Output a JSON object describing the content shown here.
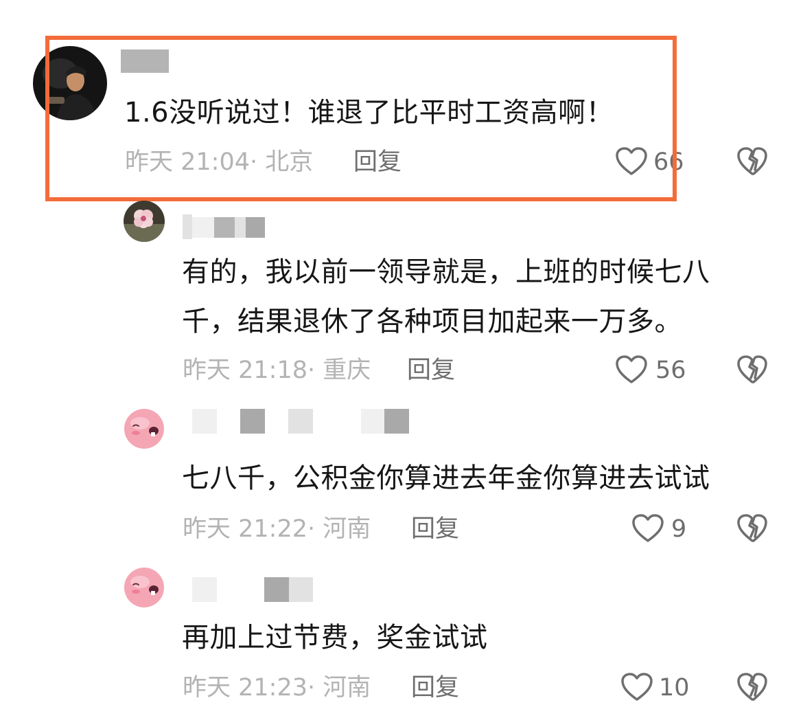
{
  "comments": [
    {
      "text_lines": [
        "1.6没听说过！谁退了比平时工资高啊！"
      ],
      "time": "昨天 21:04",
      "location": "· 北京",
      "reply_label": "回复",
      "likes": "66",
      "highlighted": true
    },
    {
      "text_lines": [
        "有的，我以前一领导就是，上班的时候七八",
        "千，结果退休了各种项目加起来一万多。"
      ],
      "time": "昨天 21:18",
      "location": "· 重庆",
      "reply_label": "回复",
      "likes": "56"
    },
    {
      "text_lines": [
        "七八千，公积金你算进去年金你算进去试试"
      ],
      "time": "昨天 21:22",
      "location": "· 河南",
      "reply_label": "回复",
      "likes": "9"
    },
    {
      "text_lines": [
        "再加上过节费，奖金试试"
      ],
      "time": "昨天 21:23",
      "location": "· 河南",
      "reply_label": "回复",
      "likes": "10"
    }
  ],
  "icons": {
    "like": "heart-outline-icon",
    "dislike": "broken-heart-icon"
  },
  "colors": {
    "highlight_border": "#f26c3a",
    "text": "#161616",
    "meta": "#b3b3b3",
    "action": "#6e6e6e"
  }
}
